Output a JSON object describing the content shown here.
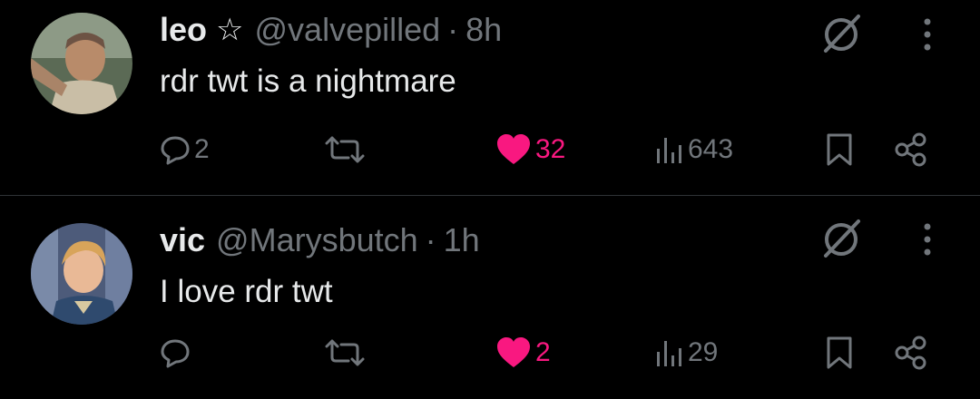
{
  "posts": [
    {
      "name": "leo",
      "badge_icon": "star-icon",
      "handle": "@valvepilled",
      "separator": "·",
      "time": "8h",
      "text": "rdr twt is a nightmare",
      "replies": "2",
      "reposts": "",
      "likes": "32",
      "liked": true,
      "views": "643"
    },
    {
      "name": "vic",
      "handle": "@Marysbutch",
      "separator": "·",
      "time": "1h",
      "text": "I love rdr twt",
      "replies": "",
      "reposts": "",
      "likes": "2",
      "liked": true,
      "views": "29"
    }
  ],
  "colors": {
    "background": "#000000",
    "text": "#e7e9ea",
    "secondary": "#71767b",
    "like": "#f91880",
    "divider": "#2f3336"
  },
  "icons": {
    "reply": "reply-bubble-icon",
    "repost": "repost-arrows-icon",
    "like": "heart-icon",
    "views": "views-bar-chart-icon",
    "bookmark": "bookmark-icon",
    "share": "share-nodes-icon",
    "grok": "grok-icon",
    "more": "more-vertical-icon"
  }
}
